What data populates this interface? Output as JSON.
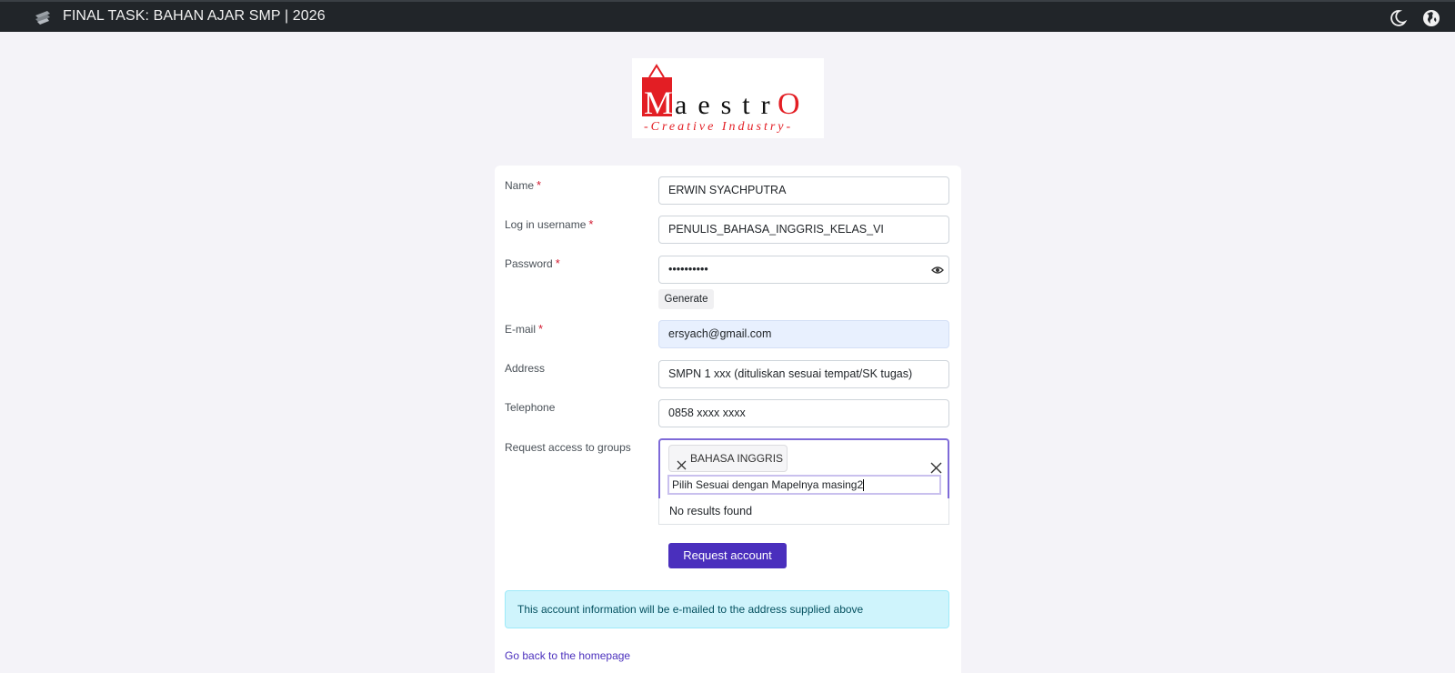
{
  "header": {
    "title": "FINAL TASK: BAHAN AJAR SMP | 2026",
    "icons": [
      "site-logo-icon",
      "moon-icon",
      "globe-icon"
    ]
  },
  "logo": {
    "name": "aestr",
    "subtitle": "-Creative Industry-"
  },
  "form": {
    "name": {
      "label": "Name",
      "value": "ERWIN SYACHPUTRA"
    },
    "username": {
      "label": "Log in username",
      "value": "PENULIS_BAHASA_INGGRIS_KELAS_VI"
    },
    "password": {
      "label": "Password",
      "value": "••••••••••",
      "generate_label": "Generate"
    },
    "email": {
      "label": "E-mail",
      "value": "ersyach@gmail.com"
    },
    "address": {
      "label": "Address",
      "value": "SMPN 1 xxx (dituliskan sesuai tempat/SK tugas)"
    },
    "telephone": {
      "label": "Telephone",
      "value": "0858 xxxx xxxx"
    },
    "groups": {
      "label": "Request access to groups",
      "selected": [
        "BAHASA INGGRIS"
      ],
      "search_value": "Pilih Sesuai dengan Mapelnya masing2",
      "no_results": "No results found"
    },
    "required_marker": "*",
    "submit_label": "Request account"
  },
  "info_message": "This account information will be e-mailed to the address supplied above",
  "home_link": "Go back to the homepage",
  "colors": {
    "navbar": "#212529",
    "primary": "#4a2fbd",
    "info_bg": "#cff4fc",
    "required": "#d21a30",
    "logo_red": "#e31e24"
  }
}
